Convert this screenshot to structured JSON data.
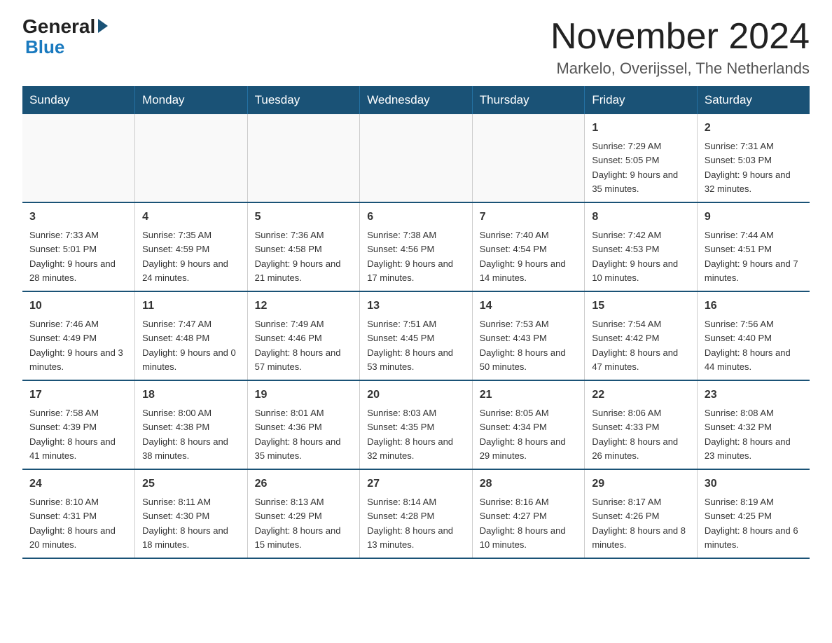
{
  "header": {
    "logo_text": "General",
    "logo_blue": "Blue",
    "month_title": "November 2024",
    "location": "Markelo, Overijssel, The Netherlands"
  },
  "weekdays": [
    "Sunday",
    "Monday",
    "Tuesday",
    "Wednesday",
    "Thursday",
    "Friday",
    "Saturday"
  ],
  "weeks": [
    [
      {
        "day": "",
        "info": ""
      },
      {
        "day": "",
        "info": ""
      },
      {
        "day": "",
        "info": ""
      },
      {
        "day": "",
        "info": ""
      },
      {
        "day": "",
        "info": ""
      },
      {
        "day": "1",
        "info": "Sunrise: 7:29 AM\nSunset: 5:05 PM\nDaylight: 9 hours and 35 minutes."
      },
      {
        "day": "2",
        "info": "Sunrise: 7:31 AM\nSunset: 5:03 PM\nDaylight: 9 hours and 32 minutes."
      }
    ],
    [
      {
        "day": "3",
        "info": "Sunrise: 7:33 AM\nSunset: 5:01 PM\nDaylight: 9 hours and 28 minutes."
      },
      {
        "day": "4",
        "info": "Sunrise: 7:35 AM\nSunset: 4:59 PM\nDaylight: 9 hours and 24 minutes."
      },
      {
        "day": "5",
        "info": "Sunrise: 7:36 AM\nSunset: 4:58 PM\nDaylight: 9 hours and 21 minutes."
      },
      {
        "day": "6",
        "info": "Sunrise: 7:38 AM\nSunset: 4:56 PM\nDaylight: 9 hours and 17 minutes."
      },
      {
        "day": "7",
        "info": "Sunrise: 7:40 AM\nSunset: 4:54 PM\nDaylight: 9 hours and 14 minutes."
      },
      {
        "day": "8",
        "info": "Sunrise: 7:42 AM\nSunset: 4:53 PM\nDaylight: 9 hours and 10 minutes."
      },
      {
        "day": "9",
        "info": "Sunrise: 7:44 AM\nSunset: 4:51 PM\nDaylight: 9 hours and 7 minutes."
      }
    ],
    [
      {
        "day": "10",
        "info": "Sunrise: 7:46 AM\nSunset: 4:49 PM\nDaylight: 9 hours and 3 minutes."
      },
      {
        "day": "11",
        "info": "Sunrise: 7:47 AM\nSunset: 4:48 PM\nDaylight: 9 hours and 0 minutes."
      },
      {
        "day": "12",
        "info": "Sunrise: 7:49 AM\nSunset: 4:46 PM\nDaylight: 8 hours and 57 minutes."
      },
      {
        "day": "13",
        "info": "Sunrise: 7:51 AM\nSunset: 4:45 PM\nDaylight: 8 hours and 53 minutes."
      },
      {
        "day": "14",
        "info": "Sunrise: 7:53 AM\nSunset: 4:43 PM\nDaylight: 8 hours and 50 minutes."
      },
      {
        "day": "15",
        "info": "Sunrise: 7:54 AM\nSunset: 4:42 PM\nDaylight: 8 hours and 47 minutes."
      },
      {
        "day": "16",
        "info": "Sunrise: 7:56 AM\nSunset: 4:40 PM\nDaylight: 8 hours and 44 minutes."
      }
    ],
    [
      {
        "day": "17",
        "info": "Sunrise: 7:58 AM\nSunset: 4:39 PM\nDaylight: 8 hours and 41 minutes."
      },
      {
        "day": "18",
        "info": "Sunrise: 8:00 AM\nSunset: 4:38 PM\nDaylight: 8 hours and 38 minutes."
      },
      {
        "day": "19",
        "info": "Sunrise: 8:01 AM\nSunset: 4:36 PM\nDaylight: 8 hours and 35 minutes."
      },
      {
        "day": "20",
        "info": "Sunrise: 8:03 AM\nSunset: 4:35 PM\nDaylight: 8 hours and 32 minutes."
      },
      {
        "day": "21",
        "info": "Sunrise: 8:05 AM\nSunset: 4:34 PM\nDaylight: 8 hours and 29 minutes."
      },
      {
        "day": "22",
        "info": "Sunrise: 8:06 AM\nSunset: 4:33 PM\nDaylight: 8 hours and 26 minutes."
      },
      {
        "day": "23",
        "info": "Sunrise: 8:08 AM\nSunset: 4:32 PM\nDaylight: 8 hours and 23 minutes."
      }
    ],
    [
      {
        "day": "24",
        "info": "Sunrise: 8:10 AM\nSunset: 4:31 PM\nDaylight: 8 hours and 20 minutes."
      },
      {
        "day": "25",
        "info": "Sunrise: 8:11 AM\nSunset: 4:30 PM\nDaylight: 8 hours and 18 minutes."
      },
      {
        "day": "26",
        "info": "Sunrise: 8:13 AM\nSunset: 4:29 PM\nDaylight: 8 hours and 15 minutes."
      },
      {
        "day": "27",
        "info": "Sunrise: 8:14 AM\nSunset: 4:28 PM\nDaylight: 8 hours and 13 minutes."
      },
      {
        "day": "28",
        "info": "Sunrise: 8:16 AM\nSunset: 4:27 PM\nDaylight: 8 hours and 10 minutes."
      },
      {
        "day": "29",
        "info": "Sunrise: 8:17 AM\nSunset: 4:26 PM\nDaylight: 8 hours and 8 minutes."
      },
      {
        "day": "30",
        "info": "Sunrise: 8:19 AM\nSunset: 4:25 PM\nDaylight: 8 hours and 6 minutes."
      }
    ]
  ]
}
